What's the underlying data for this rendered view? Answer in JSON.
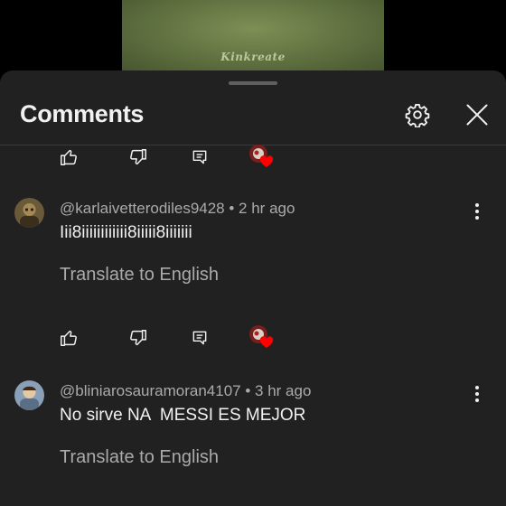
{
  "video": {
    "watermark": "Kinkreate"
  },
  "header": {
    "title": "Comments",
    "settings_icon": "gear-icon",
    "close_icon": "close-icon"
  },
  "colors": {
    "sheet_bg": "#212121",
    "text_primary": "#f1f1f1",
    "text_secondary": "#aaaaaa",
    "heart": "#ff0000"
  },
  "actions": {
    "like_icon": "thumb-up-icon",
    "dislike_icon": "thumb-down-icon",
    "reply_icon": "reply-icon",
    "creator_heart_icon": "creator-heart-icon"
  },
  "comments": [
    {
      "author": "@karlaivetterodiles9428",
      "time": "2 hr ago",
      "text": "Iii8iiiiiiiiiiii8iiiii8iiiiiii",
      "translate": "Translate to English"
    },
    {
      "author": "@bliniarosauramoran4107",
      "time": "3 hr ago",
      "text": "No sirve NA  MESSI ES MEJOR",
      "translate": "Translate to English"
    }
  ],
  "separator": " • "
}
